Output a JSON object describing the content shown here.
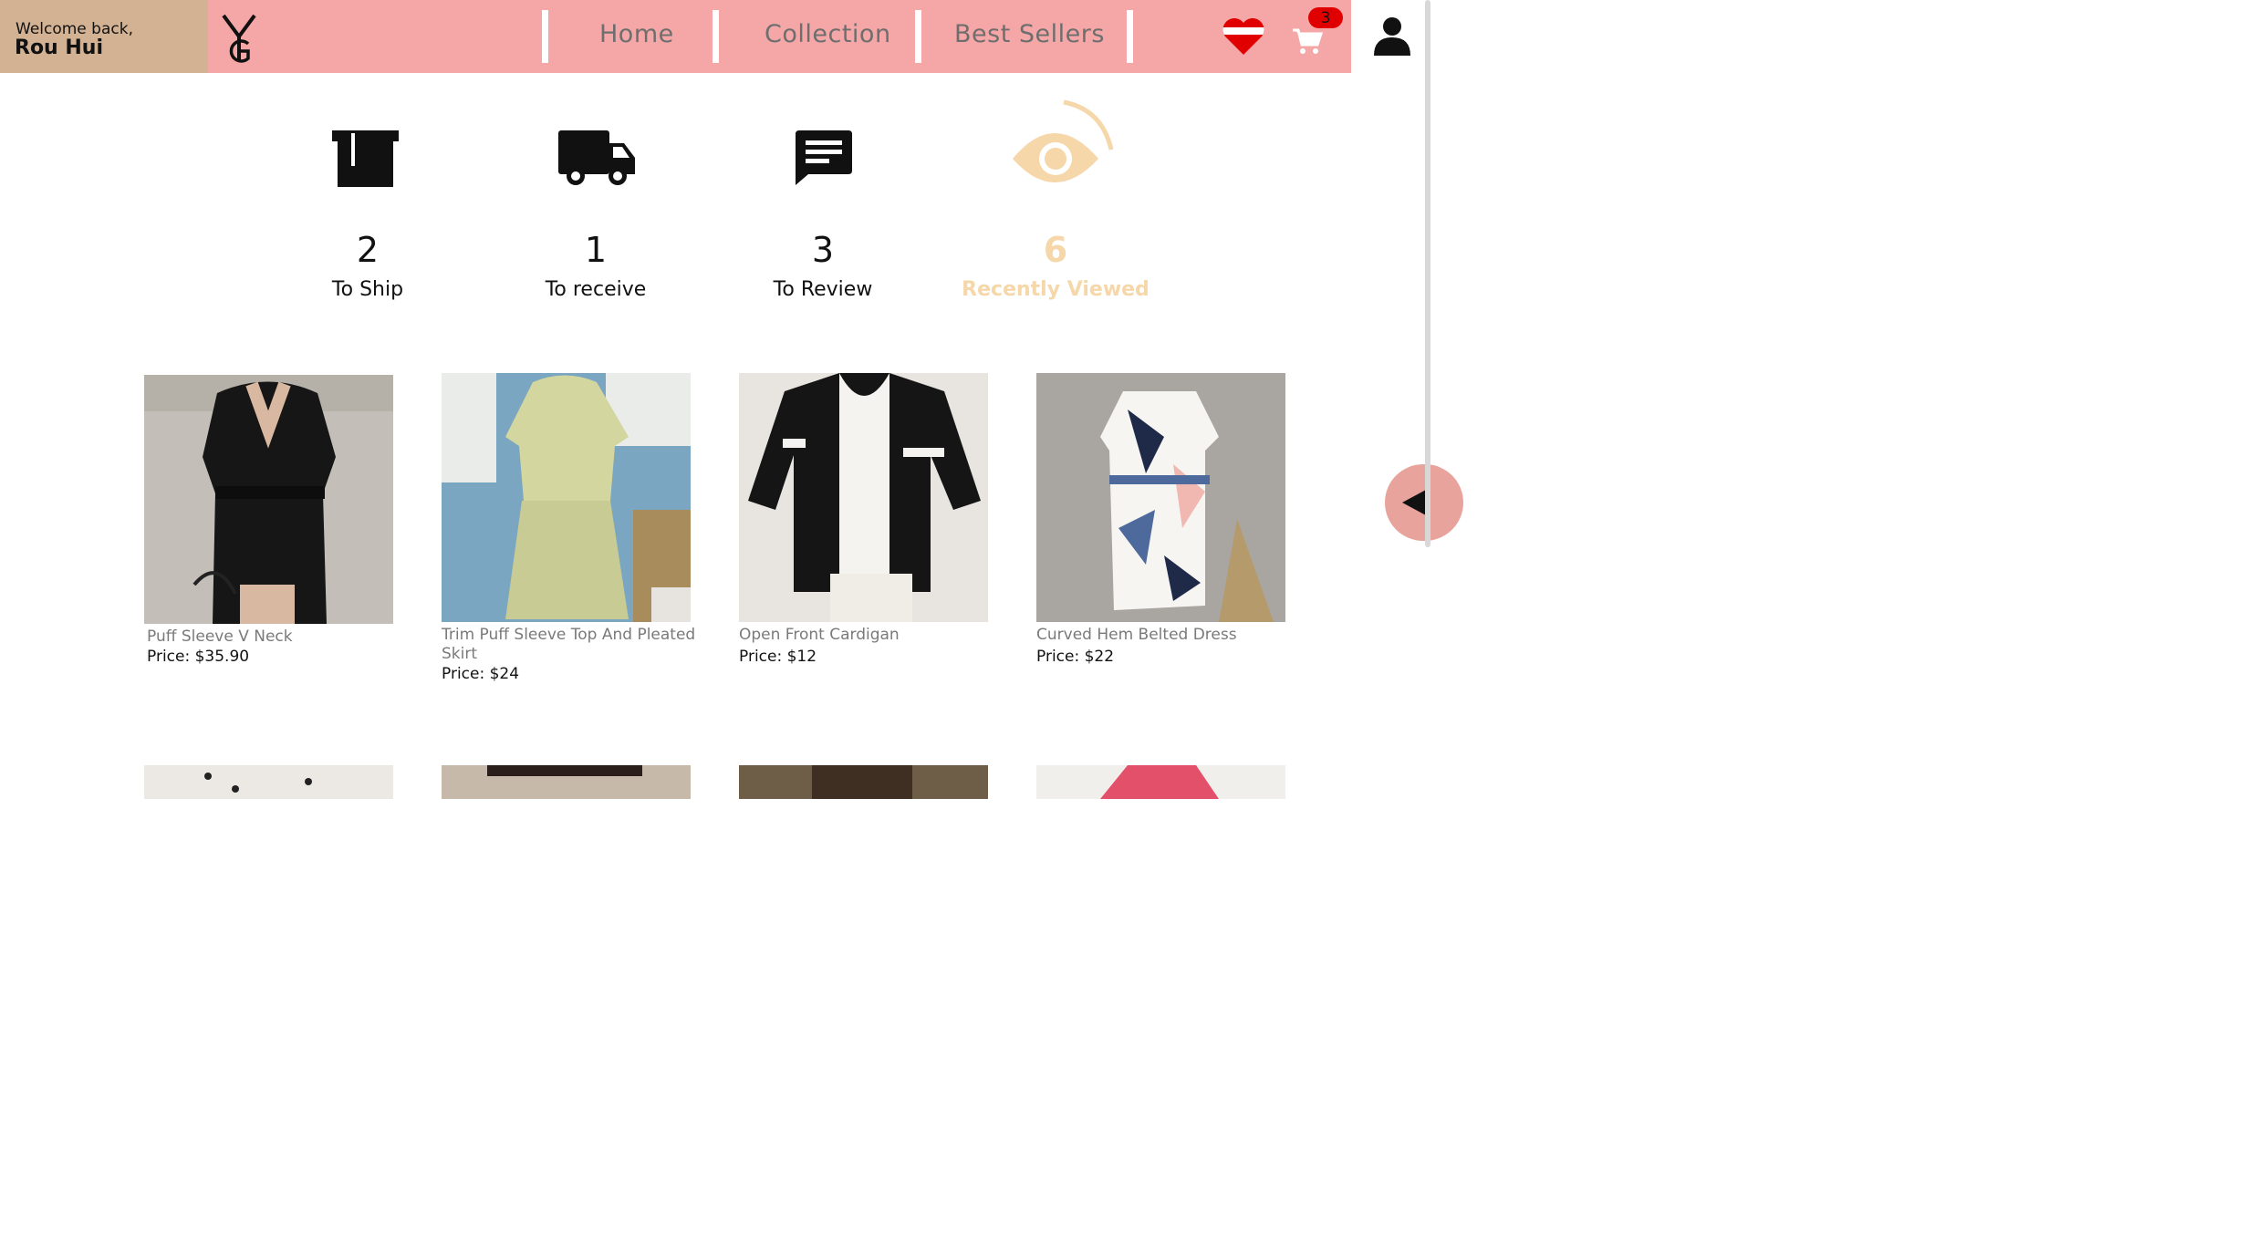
{
  "header": {
    "welcome_line1": "Welcome back,",
    "user_name": "Rou Hui",
    "nav": [
      "Home",
      "Collection",
      "Best Sellers"
    ],
    "cart_count": "3",
    "icons": [
      "logo-icon",
      "heart-icon",
      "cart-icon",
      "user-icon"
    ]
  },
  "status": [
    {
      "count": "2",
      "label": "To Ship",
      "icon": "box-icon"
    },
    {
      "count": "1",
      "label": "To receive",
      "icon": "truck-icon"
    },
    {
      "count": "3",
      "label": "To Review",
      "icon": "chat-icon"
    },
    {
      "count": "6",
      "label": "Recently Viewed",
      "icon": "eye-icon"
    }
  ],
  "products": [
    {
      "name": "Puff Sleeve V Neck",
      "price": "Price: $35.90"
    },
    {
      "name": "Trim Puff Sleeve Top And Pleated Skirt",
      "price": "Price: $24"
    },
    {
      "name": "Open Front Cardigan",
      "price": "Price: $12"
    },
    {
      "name": "Curved Hem Belted Dress",
      "price": "Price: $22"
    }
  ],
  "colors": {
    "welcome_bg": "#d3b294",
    "nav_bg": "#f5a7a7",
    "highlight": "#f5d7aa",
    "badge": "#e00000"
  }
}
